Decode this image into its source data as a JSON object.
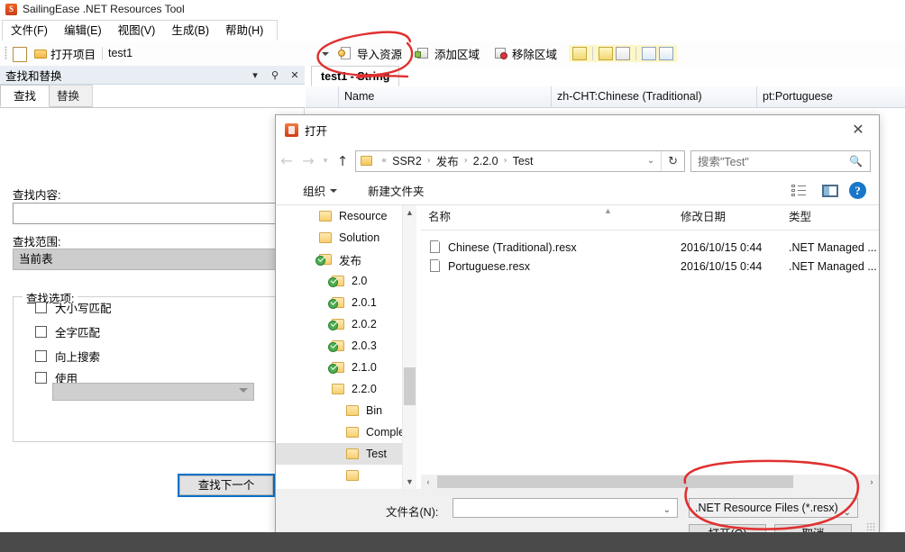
{
  "app": {
    "title": "SailingEase .NET Resources Tool",
    "icon": "app-icon",
    "menu": [
      "文件(F)",
      "编辑(E)",
      "视图(V)",
      "生成(B)",
      "帮助(H)"
    ],
    "toolbar": {
      "open_project": "打开项目",
      "project_name": "test1"
    }
  },
  "find_pane": {
    "title": "查找和替换",
    "header_buttons": [
      "▾",
      "pin-icon",
      "✕"
    ],
    "tabs": [
      {
        "label": "查找",
        "active": true
      },
      {
        "label": "替换",
        "active": false
      }
    ],
    "find_what_label": "查找内容:",
    "find_what_value": "",
    "scope_label": "查找范围:",
    "scope_value": "当前表",
    "options_label": "查找选项:",
    "options": [
      {
        "label": "大小写匹配",
        "checked": false
      },
      {
        "label": "全字匹配",
        "checked": false
      },
      {
        "label": "向上搜索",
        "checked": false
      },
      {
        "label": "使用",
        "checked": false
      }
    ],
    "use_dropdown_value": "",
    "find_next_button": "查找下一个"
  },
  "editor": {
    "toolbar": {
      "import_resource": "导入资源",
      "add_region": "添加区域",
      "remove_region": "移除区域"
    },
    "tab": "test1 - String",
    "columns": [
      "Name",
      "zh-CHT:Chinese (Traditional)",
      "pt:Portuguese"
    ]
  },
  "dialog": {
    "title": "打开",
    "close_label": "✕",
    "nav": {
      "back": "←",
      "forward": "→",
      "recent": "▾",
      "up": "↑",
      "breadcrumb_prefix": "«",
      "breadcrumb": [
        "SSR2",
        "发布",
        "2.2.0",
        "Test"
      ],
      "breadcrumb_chevron": "⌄",
      "refresh": "↻",
      "search_placeholder": "搜索\"Test\"",
      "search_value": "",
      "search_icon": "magnifier-icon"
    },
    "commandbar": {
      "organize": "组织",
      "new_folder": "新建文件夹",
      "view_icon": "list-view-icon",
      "preview_icon": "preview-pane-icon",
      "help_icon": "help-icon",
      "help_glyph": "?"
    },
    "sidebar": [
      {
        "label": "Resource",
        "indent": 0,
        "checked": false,
        "selected": false
      },
      {
        "label": "Solution",
        "indent": 0,
        "checked": false,
        "selected": false
      },
      {
        "label": "发布",
        "indent": 0,
        "checked": true,
        "selected": false
      },
      {
        "label": "2.0",
        "indent": 1,
        "checked": true,
        "selected": false
      },
      {
        "label": "2.0.1",
        "indent": 1,
        "checked": true,
        "selected": false
      },
      {
        "label": "2.0.2",
        "indent": 1,
        "checked": true,
        "selected": false
      },
      {
        "label": "2.0.3",
        "indent": 1,
        "checked": true,
        "selected": false
      },
      {
        "label": "2.1.0",
        "indent": 1,
        "checked": true,
        "selected": false
      },
      {
        "label": "2.2.0",
        "indent": 1,
        "checked": false,
        "selected": false
      },
      {
        "label": "Bin",
        "indent": 2,
        "checked": false,
        "selected": false
      },
      {
        "label": "Comple",
        "indent": 2,
        "checked": false,
        "selected": false
      },
      {
        "label": "Test",
        "indent": 2,
        "checked": false,
        "selected": true
      }
    ],
    "filelist": {
      "columns": [
        "名称",
        "修改日期",
        "类型"
      ],
      "rows": [
        {
          "name": "Chinese (Traditional).resx",
          "date": "2016/10/15 0:44",
          "type": ".NET Managed ..."
        },
        {
          "name": "Portuguese.resx",
          "date": "2016/10/15 0:44",
          "type": ".NET Managed ..."
        }
      ],
      "hscroll_left": "‹",
      "hscroll_right": "›"
    },
    "footer": {
      "filename_label": "文件名(N):",
      "filename_value": "",
      "filetype_value": ".NET Resource Files (*.resx)",
      "open_button": "打开(O)",
      "cancel_button": "取消"
    }
  },
  "annotations": {
    "color": "#e03030",
    "marks": [
      "circle-import-resource",
      "strikethrough-tab-string",
      "circle-filetype-and-buttons"
    ]
  }
}
